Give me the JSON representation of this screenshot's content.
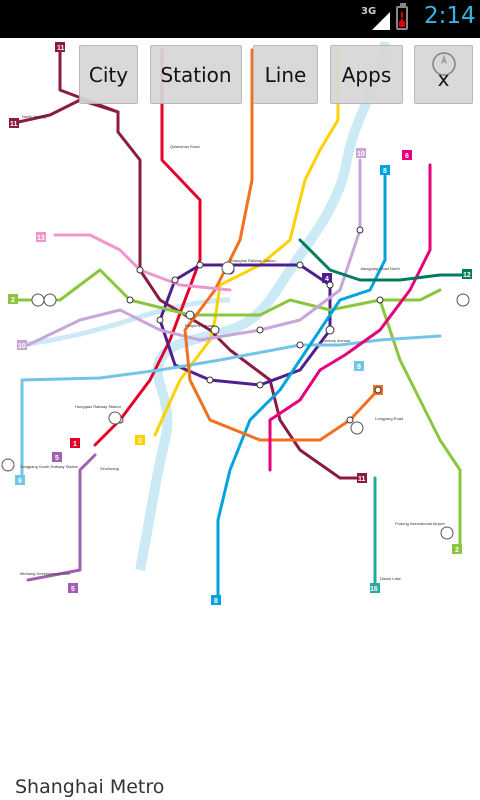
{
  "status_bar": {
    "network": "3G",
    "time": "2:14",
    "battery_level": 0.3
  },
  "toolbar": {
    "city_label": "City",
    "station_label": "Station",
    "line_label": "Line",
    "apps_label": "Apps",
    "close_label": "x"
  },
  "map": {
    "line_colors": {
      "line1": "#e4002b",
      "line2": "#8cc63f",
      "line3": "#ffd100",
      "line4": "#4f1f91",
      "line5": "#a05eb5",
      "line6": "#e5007e",
      "line7": "#f37021",
      "line8": "#00a3e0",
      "line9": "#71c5e8",
      "line10": "#c6a7d8",
      "line11": "#8b1c3f",
      "line12": "#007b5f",
      "line13": "#ef95cf",
      "line16": "#2aa8a0"
    },
    "labels": {
      "line1": "1",
      "line2": "2",
      "line3": "3",
      "line4": "4",
      "line5": "5",
      "line6": "6",
      "line7": "7",
      "line8": "8",
      "line9": "9",
      "line10": "10",
      "line11": "11",
      "line12": "12",
      "line13": "13",
      "line16": "16",
      "terminal": "Shanghai Railway Station",
      "hongqiao": "Hongqiao Railway Station",
      "peoples_sq": "People's Square",
      "century": "Century Avenue",
      "pudong": "Pudong International Airport",
      "xinzhuang": "Xinzhuang",
      "minhang": "Minhang Development Zone",
      "dishui": "Dishui Lake",
      "songjiang": "Songjiang South Railway Station",
      "north_jiading": "North Jiading",
      "longyang": "Longyang Road",
      "qilianshan": "Qilianshan Road",
      "jiangyang": "Jiangyang Road North"
    }
  },
  "footer": {
    "title": "Shanghai Metro"
  }
}
